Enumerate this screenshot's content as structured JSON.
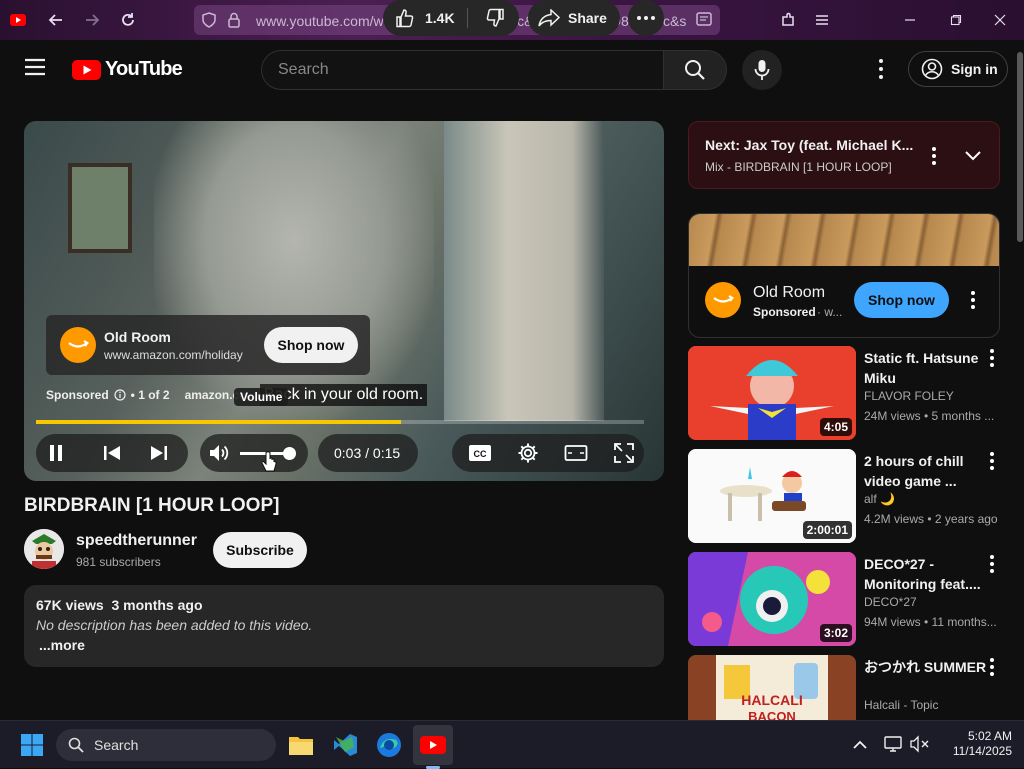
{
  "browser": {
    "url": "www.youtube.com/watch?v=Xb2JD8BqY3c&list=RDXb2JD8BqY3c&start"
  },
  "header": {
    "logo_text": "YouTube",
    "search_placeholder": "Search",
    "signin_label": "Sign in"
  },
  "player": {
    "ad_title": "Old Room",
    "ad_url": "www.amazon.com/holiday",
    "ad_shop_label": "Shop now",
    "sponsored_label": "Sponsored",
    "ad_count": "• 1 of 2",
    "ad_domain": "amazon.co",
    "caption": "Back in your old room.",
    "tooltip": "Volume",
    "time": "0:03 / 0:15",
    "progress_fraction": 0.6,
    "volume_fraction": 0.9
  },
  "video": {
    "title": "BIRDBRAIN [1 HOUR LOOP]",
    "channel": "speedtherunner",
    "subscribers": "981 subscribers",
    "subscribe_label": "Subscribe",
    "likes": "1.4K",
    "share_label": "Share",
    "views_date": "67K views  3 months ago",
    "description": "No description has been added to this video.",
    "more_label": "...more"
  },
  "next": {
    "title": "Next: Jax Toy (feat. Michael K...",
    "subtitle": "Mix - BIRDBRAIN [1 HOUR LOOP]"
  },
  "side_ad": {
    "title": "Old Room",
    "sponsored": "Sponsored",
    "dot": "· w...",
    "shop_label": "Shop now"
  },
  "recommendations": [
    {
      "title": "Static ft. Hatsune Miku",
      "channel": "FLAVOR FOLEY",
      "meta": "24M views • 5 months ...",
      "duration": "4:05"
    },
    {
      "title": "2 hours of chill video game ...",
      "channel": "alf 🌙",
      "meta": "4.2M views • 2 years ago",
      "duration": "2:00:01"
    },
    {
      "title": "DECO*27 - Monitoring feat....",
      "channel": "DECO*27",
      "meta": "94M views • 11 months...",
      "duration": "3:02"
    },
    {
      "title": "おつかれ SUMMER",
      "channel": "Halcali - Topic",
      "meta": "",
      "duration": ""
    }
  ],
  "taskbar": {
    "search_label": "Search",
    "time": "5:02 AM",
    "date": "11/14/2025"
  },
  "colors": {
    "accent": "#ff0000",
    "progress": "#f5c800",
    "shop_blue": "#3ea6ff",
    "amazon": "#ff9900"
  }
}
